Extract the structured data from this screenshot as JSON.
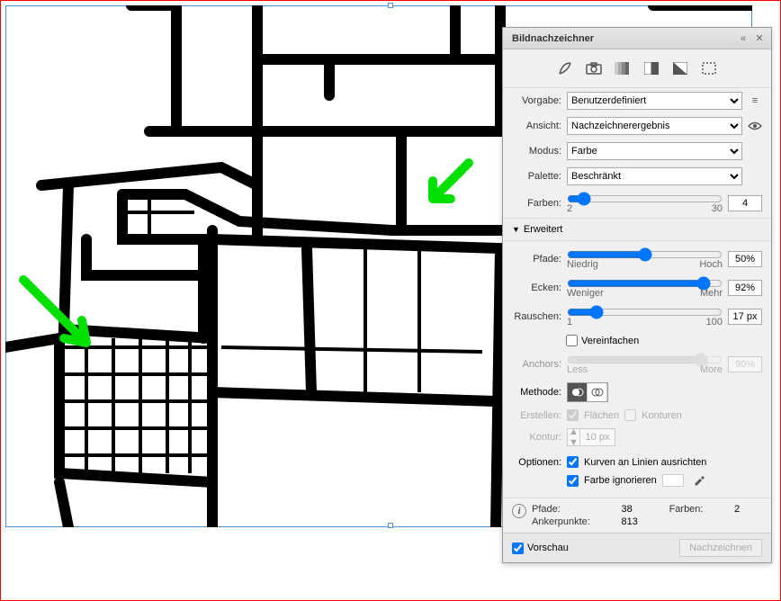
{
  "panel": {
    "title": "Bildnachzeichner",
    "preset_icons": [
      "auto-trace-icon",
      "photo-icon",
      "shades-icon",
      "grayscale-icon",
      "bw-icon",
      "outline-icon"
    ],
    "vorgabe": {
      "label": "Vorgabe:",
      "value": "Benutzerdefiniert"
    },
    "ansicht": {
      "label": "Ansicht:",
      "value": "Nachzeichnerergebnis"
    },
    "modus": {
      "label": "Modus:",
      "value": "Farbe"
    },
    "palette": {
      "label": "Palette:",
      "value": "Beschränkt"
    },
    "farben": {
      "label": "Farben:",
      "value": "4",
      "min": "2",
      "max": "30"
    },
    "erweitert": "Erweitert",
    "pfade": {
      "label": "Pfade:",
      "value": "50%",
      "min": "Niedrig",
      "max": "Hoch"
    },
    "ecken": {
      "label": "Ecken:",
      "value": "92%",
      "min": "Weniger",
      "max": "Mehr"
    },
    "rauschen": {
      "label": "Rauschen:",
      "value": "17 px",
      "min": "1",
      "max": "100"
    },
    "vereinfachen": "Vereinfachen",
    "anchors": {
      "label": "Anchors:",
      "value": "90%",
      "min": "Less",
      "max": "More"
    },
    "methode": "Methode:",
    "erstellen": {
      "label": "Erstellen:",
      "flaechen": "Flächen",
      "konturen": "Konturen"
    },
    "kontur": {
      "label": "Kontur:",
      "value": "10 px"
    },
    "optionen": {
      "label": "Optionen:",
      "kurven": "Kurven an Linien ausrichten",
      "farbe_ign": "Farbe ignorieren"
    },
    "stats": {
      "pfade_k": "Pfade:",
      "pfade_v": "38",
      "farben_k": "Farben:",
      "farben_v": "2",
      "anker_k": "Ankerpunkte:",
      "anker_v": "813"
    },
    "vorschau": "Vorschau",
    "nachzeichnen": "Nachzeichnen"
  }
}
